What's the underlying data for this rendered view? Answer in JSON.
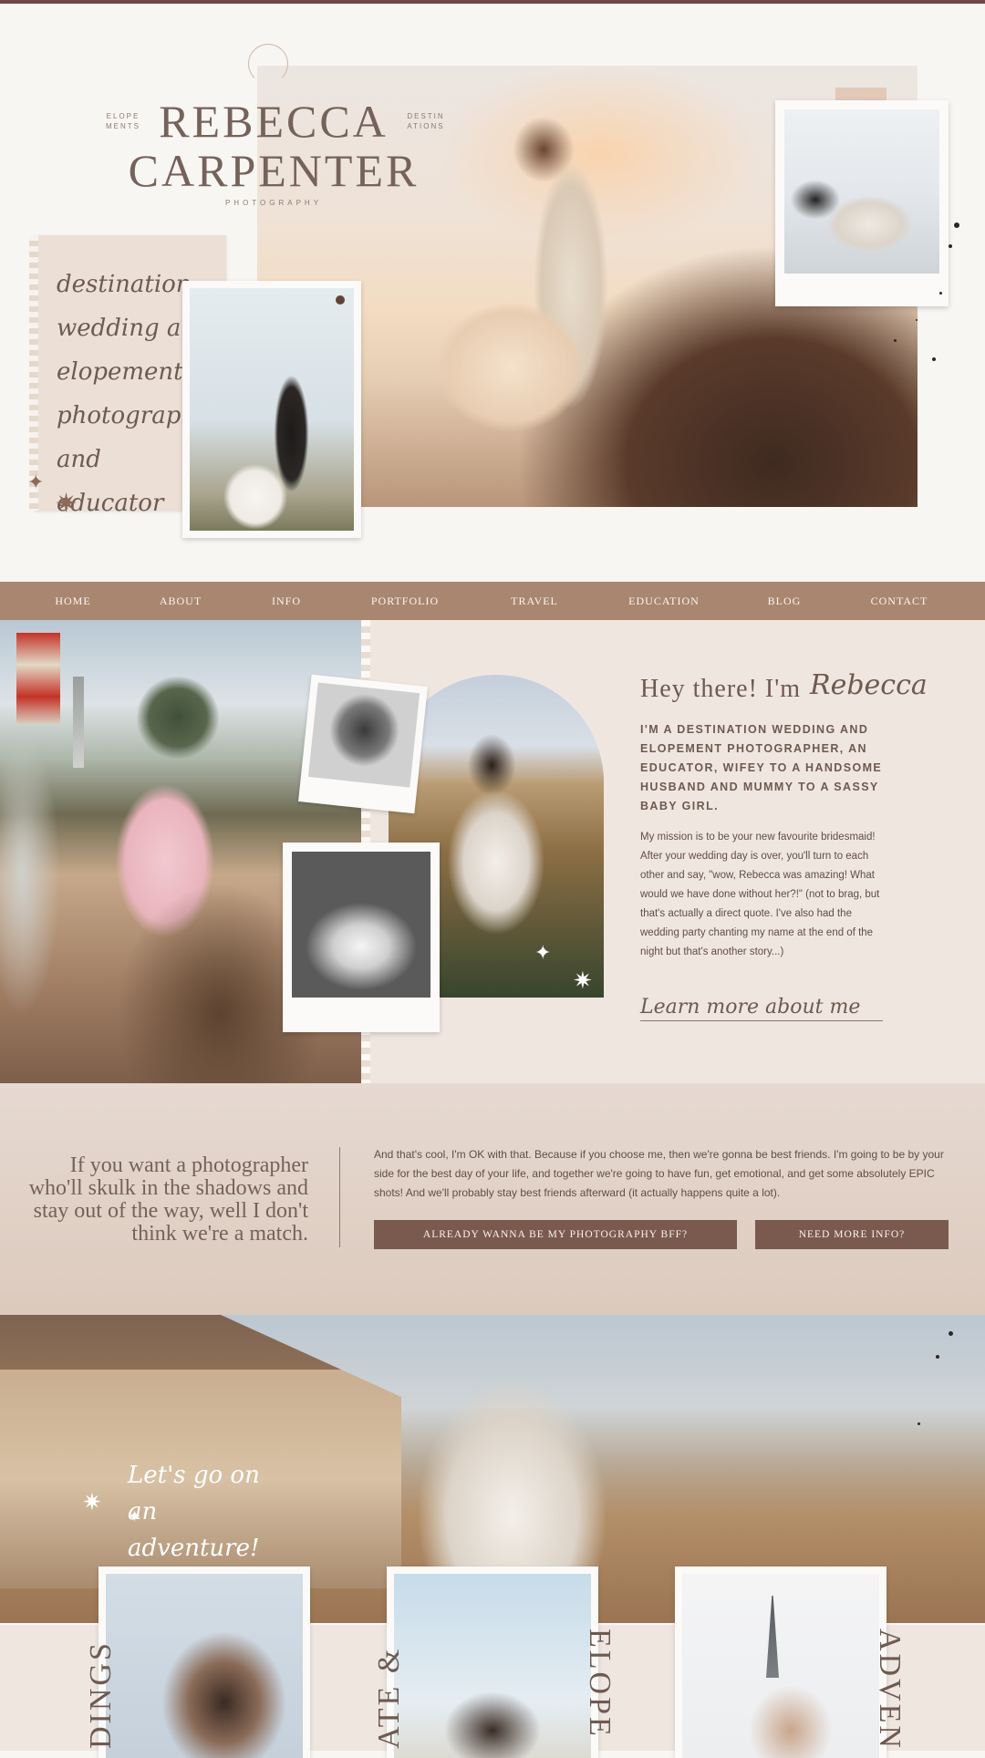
{
  "brand": {
    "title_line1": "REBECCA",
    "title_line2": "CARPENTER",
    "left_tag": "ELOPE MENTS",
    "right_tag": "DESTIN ATIONS",
    "subtitle": "PHOTOGRAPHY"
  },
  "hero": {
    "note_script": "destination wedding and elopement photographer and educator"
  },
  "nav": {
    "items": [
      "HOME",
      "ABOUT",
      "INFO",
      "PORTFOLIO",
      "TRAVEL",
      "EDUCATION",
      "BLOG",
      "CONTACT"
    ]
  },
  "about": {
    "greeting": "Hey there! I'm",
    "greeting_name": "Rebecca",
    "intro_caps": "I'M A DESTINATION WEDDING AND ELOPEMENT PHOTOGRAPHER, AN EDUCATOR, WIFEY TO A HANDSOME HUSBAND AND MUMMY TO A SASSY BABY GIRL.",
    "body": "My mission is to be your new favourite bridesmaid! After your wedding day is over, you'll turn to each other and say, \"wow, Rebecca was amazing! What would we have done without her?!\" (not to brag, but that's actually a direct quote. I've also had the wedding party chanting my name at the end of the night but that's another story...)",
    "learn_more": "Learn more about me"
  },
  "band": {
    "quote": "If you want a photographer who'll skulk in the shadows and stay out of the way, well I don't think we're a match.",
    "body": "And that's cool, I'm OK with that. Because if you choose me, then we're gonna be best friends. I'm going to be by your side for the best day of your life, and together we're going to have fun, get emotional, and get some absolutely EPIC shots! And we'll probably stay best friends afterward (it actually happens quite a lot).",
    "button_bff": "ALREADY WANNA BE MY PHOTOGRAPHY BFF?",
    "button_info": "NEED MORE INFO?"
  },
  "adventure": {
    "script": "Let's go on an adventure!"
  },
  "portfolio_labels": {
    "label_1": "DINGS",
    "label_2": "ATE &",
    "label_3": "ELOPE",
    "label_4": "ADVEN"
  }
}
